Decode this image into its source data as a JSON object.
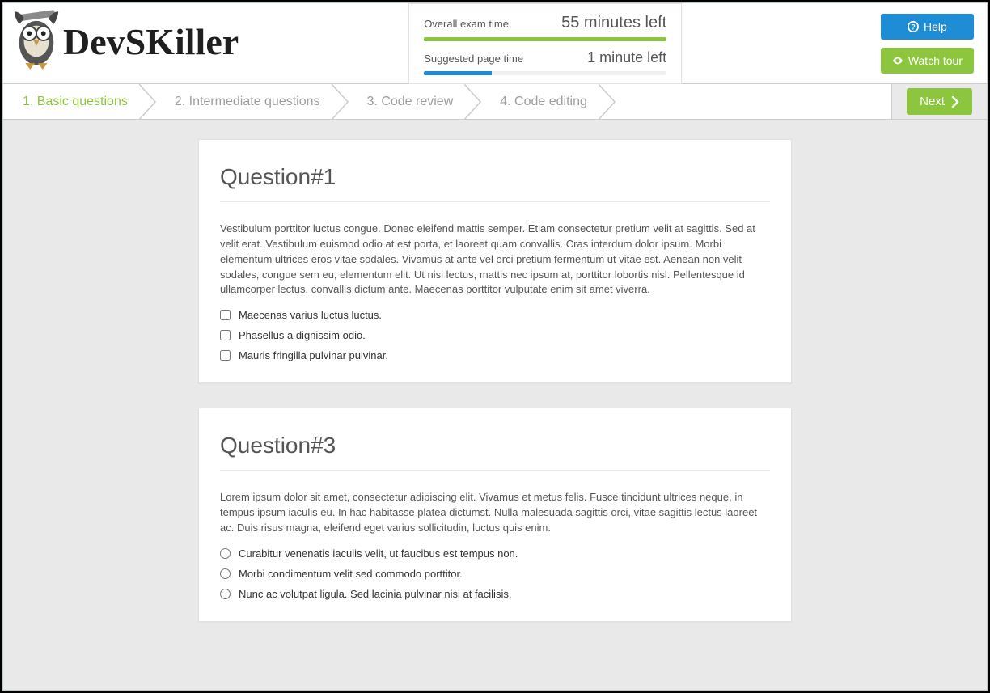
{
  "header": {
    "brand": "DevSKiller",
    "help_label": "Help",
    "watch_tour_label": "Watch tour"
  },
  "timer": {
    "overall_label": "Overall exam time",
    "overall_value": "55 minutes left",
    "page_label": "Suggested page time",
    "page_value": "1 minute left"
  },
  "steps": {
    "items": [
      {
        "label": "1. Basic questions",
        "active": true
      },
      {
        "label": "2. Intermediate questions",
        "active": false
      },
      {
        "label": "3. Code review",
        "active": false
      },
      {
        "label": "4. Code editing",
        "active": false
      }
    ],
    "next_label": "Next"
  },
  "questions": [
    {
      "title": "Question#1",
      "type": "checkbox",
      "body": "Vestibulum porttitor luctus congue. Donec eleifend mattis semper. Etiam consectetur pretium velit at sagittis. Sed at velit erat. Vestibulum euismod odio at est porta, et laoreet quam convallis. Cras interdum dolor ipsum. Morbi elementum ultrices eros vitae sodales. Vivamus at ante vel orci pretium fermentum ut vitae est. Aenean non velit sodales, congue sem eu, elementum elit. Ut nisi lectus, mattis nec ipsum at, porttitor lobortis nisl. Pellentesque id ullamcorper lectus, convallis dictum ante. Maecenas porttitor vulputate enim sit amet viverra.",
      "options": [
        "Maecenas varius luctus luctus.",
        "Phasellus a dignissim odio.",
        "Mauris fringilla pulvinar pulvinar."
      ]
    },
    {
      "title": "Question#3",
      "type": "radio",
      "body": "Lorem ipsum dolor sit amet, consectetur adipiscing elit. Vivamus et metus felis. Fusce tincidunt ultrices neque, in tempus ipsum iaculis eu. In hac habitasse platea dictumst. Nulla malesuada sagittis orci, vitae sagittis lectus laoreet ac. Duis risus magna, eleifend eget varius sollicitudin, luctus quis enim.",
      "options": [
        "Curabitur venenatis iaculis velit, ut faucibus est tempus non.",
        "Morbi condimentum velit sed commodo porttitor.",
        "Nunc ac volutpat ligula. Sed lacinia pulvinar nisi at facilisis."
      ]
    }
  ]
}
